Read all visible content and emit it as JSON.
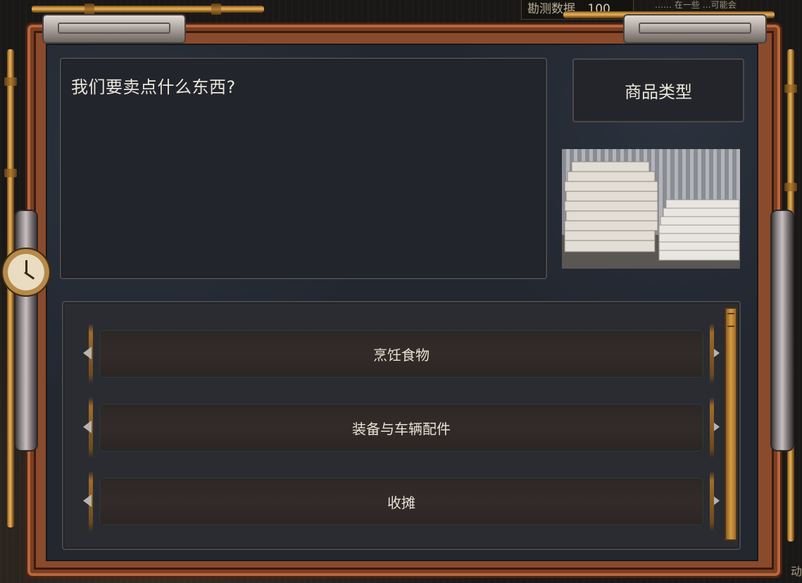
{
  "hud": {
    "survey_label": "勘测数据",
    "survey_value": "100",
    "note_text": "…… 在一些 …可能会"
  },
  "dialog": {
    "prompt": "我们要卖点什么东西?",
    "category_title": "商品类型",
    "options": [
      {
        "label": "烹饪食物"
      },
      {
        "label": "装备与车辆配件"
      },
      {
        "label": "收摊"
      }
    ]
  },
  "footer": {
    "right_text": "动"
  },
  "colors": {
    "frame": "#8a4a2c",
    "panel": "#22252c",
    "text": "#ece6da",
    "brass": "#c9913a"
  }
}
